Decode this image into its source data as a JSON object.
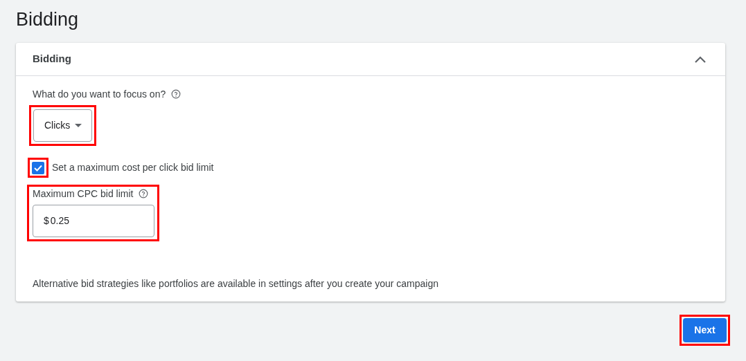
{
  "page_title": "Bidding",
  "section": {
    "title": "Bidding",
    "expanded": true,
    "focus_select": {
      "label": "What do you want to focus on?",
      "value": "Clicks",
      "highlighted": true
    },
    "max_cpc_checkbox": {
      "label": "Set a maximum cost per click bid limit",
      "checked": true,
      "highlighted": true
    },
    "max_cpc_field": {
      "label": "Maximum CPC bid limit",
      "prefix": "$",
      "value": "0.25",
      "highlighted": true
    },
    "note": "Alternative bid strategies like portfolios are available in settings after you create your campaign"
  },
  "next_button": {
    "label": "Next",
    "highlighted": true
  }
}
